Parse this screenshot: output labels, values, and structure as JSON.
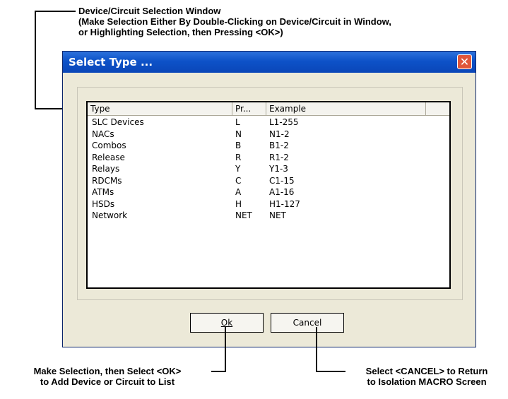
{
  "callouts": {
    "top_line1": "Device/Circuit Selection Window",
    "top_line2": "(Make Selection Either By Double-Clicking on Device/Circuit in Window,",
    "top_line3": "or Highlighting Selection, then Pressing <OK>)",
    "bottom_left_line1": "Make Selection, then Select <OK>",
    "bottom_left_line2": "to Add Device or Circuit to List",
    "bottom_right_line1": "Select <CANCEL> to Return",
    "bottom_right_line2": "to Isolation MACRO Screen"
  },
  "dialog": {
    "title": "Select Type ...",
    "close_glyph": "✕",
    "columns": [
      "Type",
      "Pr...",
      "Example"
    ],
    "rows": [
      {
        "type": "SLC Devices",
        "prefix": "L",
        "example": "L1-255"
      },
      {
        "type": "NACs",
        "prefix": "N",
        "example": "N1-2"
      },
      {
        "type": "Combos",
        "prefix": "B",
        "example": "B1-2"
      },
      {
        "type": "Release",
        "prefix": "R",
        "example": "R1-2"
      },
      {
        "type": "Relays",
        "prefix": "Y",
        "example": "Y1-3"
      },
      {
        "type": "RDCMs",
        "prefix": "C",
        "example": "C1-15"
      },
      {
        "type": "ATMs",
        "prefix": "A",
        "example": "A1-16"
      },
      {
        "type": "HSDs",
        "prefix": "H",
        "example": "H1-127"
      },
      {
        "type": "Network",
        "prefix": "NET",
        "example": "NET"
      }
    ],
    "ok_label": "Ok",
    "cancel_label": "Cancel"
  }
}
